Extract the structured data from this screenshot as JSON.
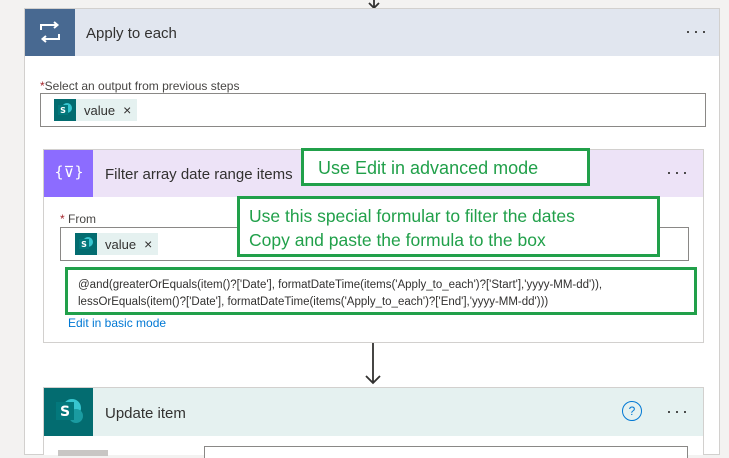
{
  "apply_to_each": {
    "title": "Apply to each",
    "menu": "···",
    "select_label": "Select an output from previous steps",
    "required_mark": "*",
    "token_label": "value",
    "token_remove": "×"
  },
  "filter_array": {
    "title": "Filter array date range items",
    "menu": "···",
    "icon_glyph": "{⊽}",
    "from_label": "From",
    "required_mark": "*",
    "token_label": "value",
    "token_remove": "×",
    "expression_line1": "@and(greaterOrEquals(item()?['Date'], formatDateTime(items('Apply_to_each')?['Start'],'yyyy-MM-dd')),",
    "expression_line2": "lessOrEquals(item()?['Date'], formatDateTime(items('Apply_to_each')?['End'],'yyyy-MM-dd')))",
    "edit_mode_link": "Edit in basic mode"
  },
  "update_item": {
    "title": "Update item",
    "help": "?",
    "menu": "···"
  },
  "annotations": {
    "advanced_mode": "Use Edit in advanced mode",
    "formula_line1": "Use this special formular to filter the dates",
    "formula_line2": "Copy and paste the formula to the box"
  },
  "colors": {
    "annotation_green": "#21a04a",
    "loop_blue": "#486991",
    "filter_purple": "#8c6cff",
    "sharepoint_teal": "#036c70",
    "link_blue": "#0078d4"
  }
}
